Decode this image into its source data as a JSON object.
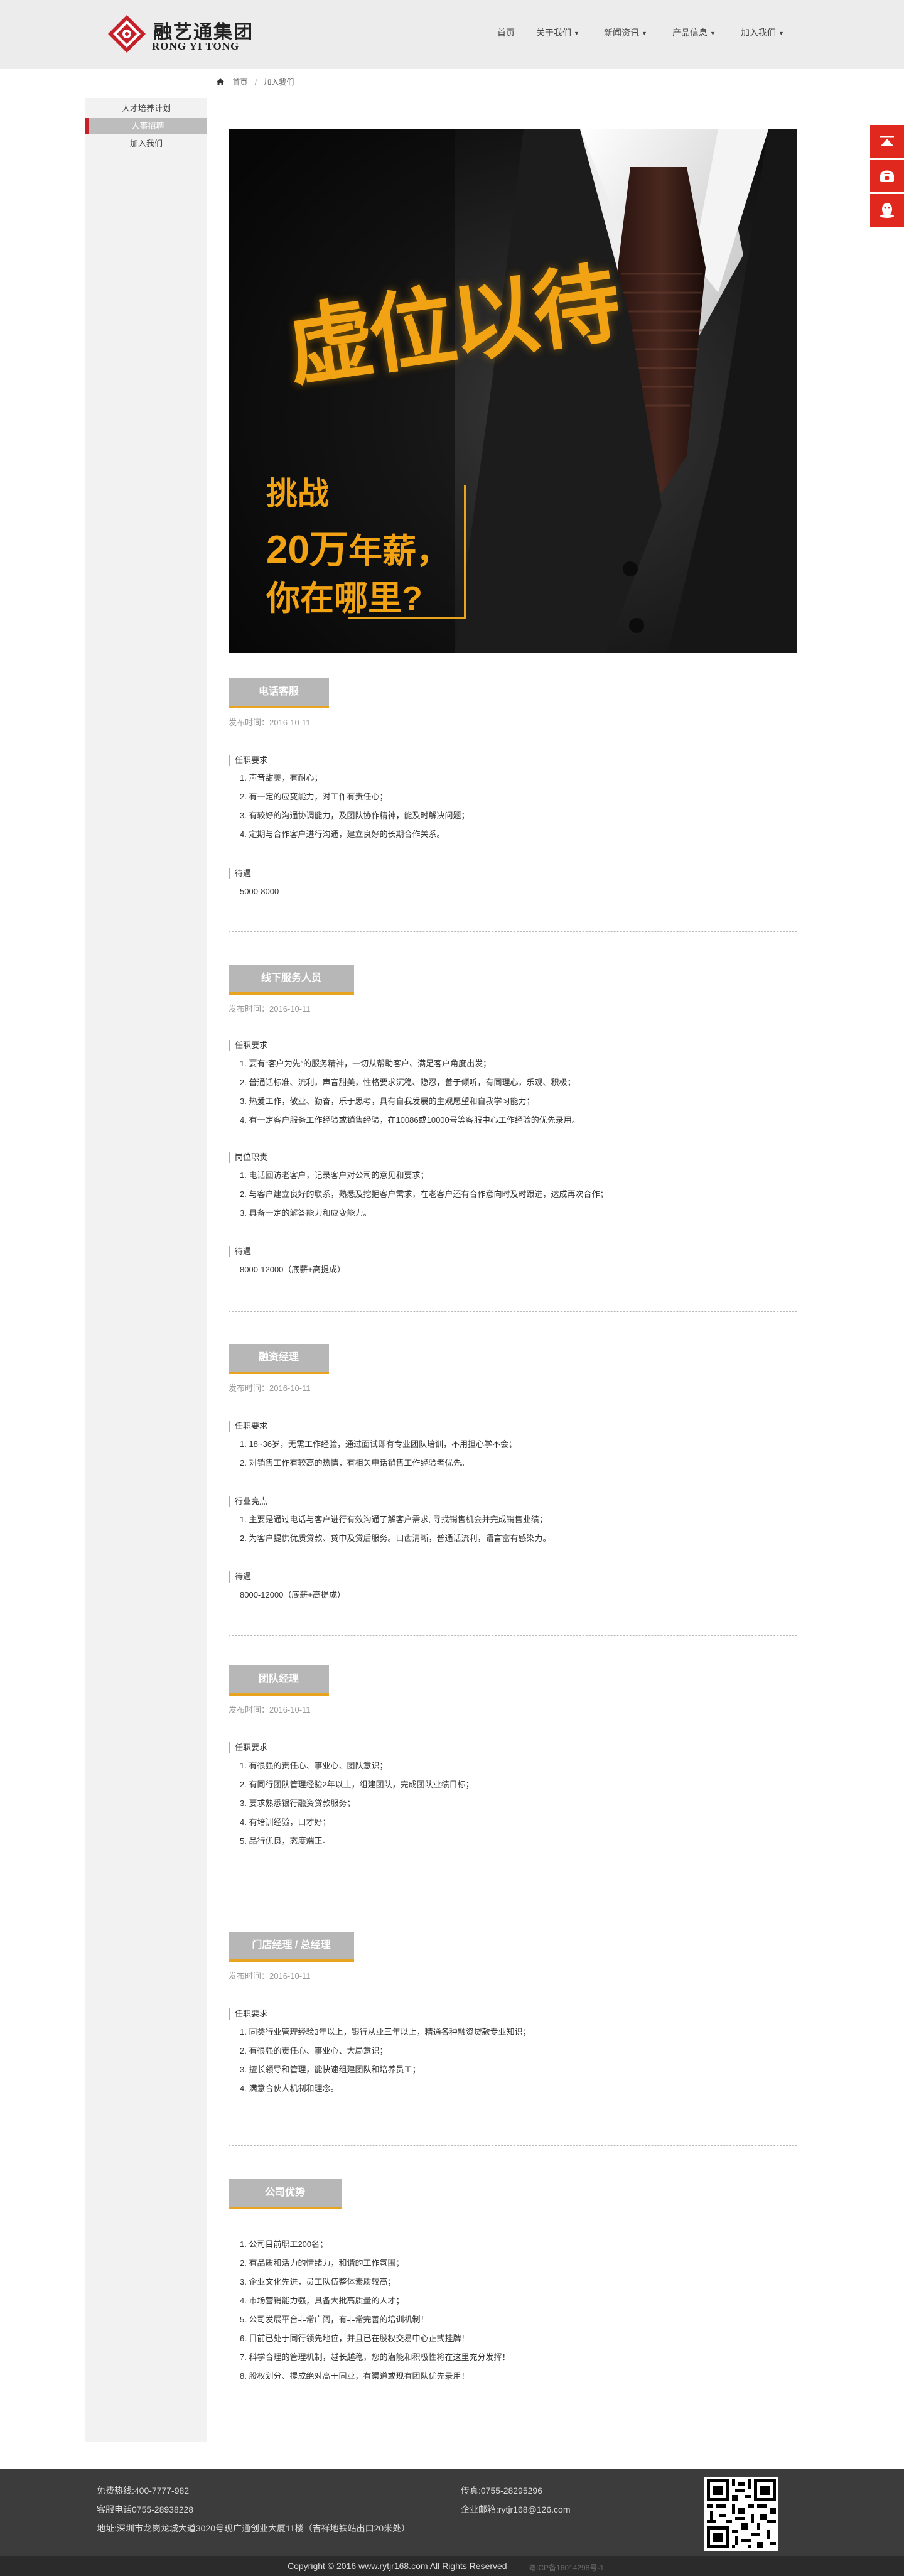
{
  "brand": {
    "name_cn": "融艺通集团",
    "name_en": "RONG YI TONG",
    "color_accent": "#e8a41e",
    "color_brand": "#c6202a"
  },
  "nav": [
    {
      "label": "首页",
      "dropdown": false
    },
    {
      "label": "关于我们",
      "dropdown": true
    },
    {
      "label": "新闻资讯",
      "dropdown": true
    },
    {
      "label": "产品信息",
      "dropdown": true
    },
    {
      "label": "加入我们",
      "dropdown": true
    }
  ],
  "breadcrumb": {
    "home": "首页",
    "current": "加入我们"
  },
  "sidebar": [
    {
      "label": "人才培养计划",
      "active": false
    },
    {
      "label": "人事招聘",
      "active": true
    },
    {
      "label": "加入我们",
      "active": false
    }
  ],
  "side_buttons": [
    "to-top-icon",
    "phone-icon",
    "qq-icon"
  ],
  "banner": {
    "headline": "虚位以待",
    "line1": "挑战",
    "line2_big": "20万",
    "line2_rest": "年薪，",
    "line3": "你在哪里?"
  },
  "jobs": [
    {
      "title": "电话客服",
      "date": "发布时间：2016-10-11",
      "sections": [
        {
          "heading": "任职要求",
          "lines": [
            "1. 声音甜美，有耐心；",
            "2. 有一定的应变能力，对工作有责任心；",
            "3. 有较好的沟通协调能力，及团队协作精神，能及时解决问题；",
            "4. 定期与合作客户进行沟通，建立良好的长期合作关系。"
          ]
        },
        {
          "heading": "待遇",
          "lines": [
            "5000-8000"
          ]
        }
      ]
    },
    {
      "title": "线下服务人员",
      "date": "发布时间：2016-10-11",
      "sections": [
        {
          "heading": "任职要求",
          "lines": [
            "1. 要有“客户为先”的服务精神，一切从帮助客户、满足客户角度出发；",
            "2. 普通话标准、流利，声音甜美，性格要求沉稳、隐忍，善于倾听，有同理心，乐观、积极；",
            "3. 热爱工作，敬业、勤奋，乐于思考，具有自我发展的主观愿望和自我学习能力；",
            "4. 有一定客户服务工作经验或销售经验，在10086或10000号等客服中心工作经验的优先录用。"
          ]
        },
        {
          "heading": "岗位职责",
          "lines": [
            "1. 电话回访老客户，记录客户对公司的意见和要求；",
            "2. 与客户建立良好的联系，熟悉及挖掘客户需求，在老客户还有合作意向时及时跟进，达成再次合作；",
            "3. 具备一定的解答能力和应变能力。"
          ]
        },
        {
          "heading": "待遇",
          "lines": [
            "8000-12000（底薪+高提成）"
          ]
        }
      ]
    },
    {
      "title": "融资经理",
      "date": "发布时间：2016-10-11",
      "sections": [
        {
          "heading": "任职要求",
          "lines": [
            "1. 18~36岁，无需工作经验，通过面试即有专业团队培训，不用担心学不会；",
            "2. 对销售工作有较高的热情，有相关电话销售工作经验者优先。"
          ]
        },
        {
          "heading": "行业亮点",
          "lines": [
            "1. 主要是通过电话与客户进行有效沟通了解客户需求, 寻找销售机会并完成销售业绩；",
            "2. 为客户提供优质贷款、贷中及贷后服务。口齿清晰，普通话流利，语言富有感染力。"
          ]
        },
        {
          "heading": "待遇",
          "lines": [
            "8000-12000（底薪+高提成）"
          ]
        }
      ]
    },
    {
      "title": "团队经理",
      "date": "发布时间：2016-10-11",
      "sections": [
        {
          "heading": "任职要求",
          "lines": [
            "1. 有很强的责任心、事业心、团队意识；",
            "2. 有同行团队管理经验2年以上，组建团队，完成团队业绩目标；",
            "3. 要求熟悉银行融资贷款服务；",
            "4. 有培训经验，口才好；",
            "5. 品行优良，态度端正。"
          ]
        }
      ]
    },
    {
      "title": "门店经理 / 总经理",
      "date": "发布时间：2016-10-11",
      "sections": [
        {
          "heading": "任职要求",
          "lines": [
            "1. 同类行业管理经验3年以上，银行从业三年以上，精通各种融资贷款专业知识；",
            "2. 有很强的责任心、事业心、大局意识；",
            "3. 擅长领导和管理，能快速组建团队和培养员工；",
            "4. 满意合伙人机制和理念。"
          ]
        }
      ]
    },
    {
      "title": "公司优势",
      "date": "",
      "sections": [
        {
          "heading": "",
          "lines": [
            "1. 公司目前职工200名；",
            "2. 有品质和活力的情绪力，和谐的工作氛围；",
            "3. 企业文化先进，员工队伍整体素质较高；",
            "4. 市场营销能力强，具备大批高质量的人才；",
            "5. 公司发展平台非常广阔，有非常完善的培训机制！",
            "6. 目前已处于同行领先地位，并且已在股权交易中心正式挂牌！",
            "7. 科学合理的管理机制，越长越稳，您的潜能和积极性将在这里充分发挥！",
            "8. 股权划分、提成绝对高于同业，有渠道或现有团队优先录用！"
          ]
        }
      ]
    }
  ],
  "footer": {
    "hotline": "免费热线:400-7777-982",
    "service_phone": "客服电话0755-28938228",
    "address": "地址:深圳市龙岗龙城大道3020号现广通创业大厦11楼（吉祥地铁站出口20米处）",
    "fax": "传真:0755-28295296",
    "email": "企业邮箱:rytjr168@126.com",
    "copyright": "Copyright © 2016 www.rytjr168.com All Rights Reserved",
    "icp": "粤ICP备16014298号-1"
  }
}
